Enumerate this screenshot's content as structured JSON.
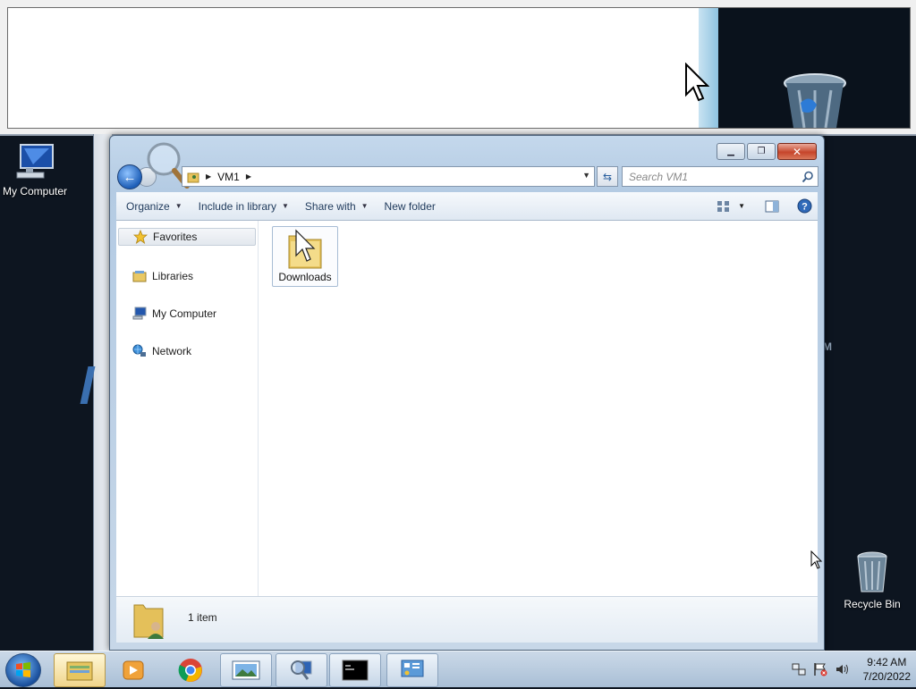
{
  "desktop": {
    "icons": [
      {
        "label": "My Computer"
      },
      {
        "label": "Recycle Bin"
      }
    ],
    "stray_text": "M"
  },
  "explorer": {
    "breadcrumb": [
      "VM1"
    ],
    "search_placeholder": "Search VM1",
    "toolbar": {
      "organize": "Organize",
      "include_in_library": "Include in library",
      "share_with": "Share with",
      "new_folder": "New folder"
    },
    "nav": {
      "favorites": "Favorites",
      "libraries": "Libraries",
      "my_computer": "My Computer",
      "network": "Network"
    },
    "files": [
      {
        "name": "Downloads",
        "type": "folder"
      }
    ],
    "details": {
      "count": "1 item"
    }
  },
  "taskbar": {
    "apps": [
      "explorer-icon",
      "media-player-icon",
      "chrome-icon",
      "photo-viewer-icon",
      "magnifier-icon",
      "cmd-icon",
      "control-panel-icon"
    ],
    "clock": {
      "time": "9:42 AM",
      "date": "7/20/2022"
    }
  },
  "colors": {
    "window_frame": "#b4cbe3",
    "accent": "#1e5fb8",
    "close": "#c6452b"
  }
}
